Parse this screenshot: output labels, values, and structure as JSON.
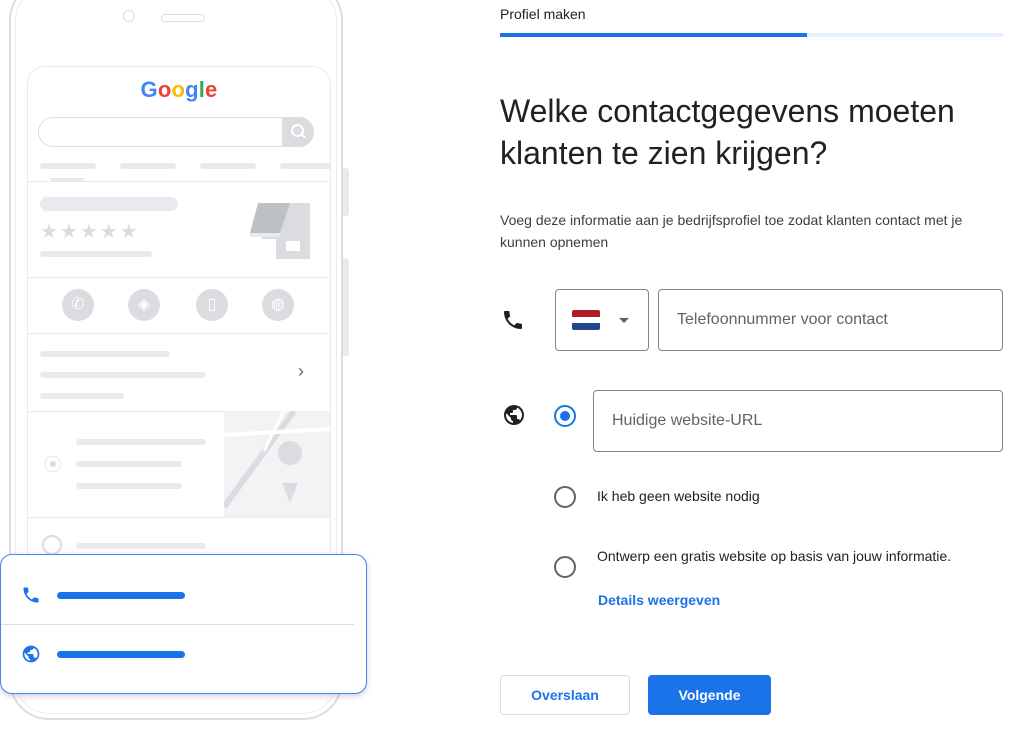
{
  "header": {
    "step_label": "Profiel maken",
    "progress": 0.61
  },
  "main": {
    "heading": "Welke contactgegevens moeten klanten te zien krijgen?",
    "description": "Voeg deze informatie aan je bedrijfsprofiel toe zodat klanten contact met je kunnen opnemen",
    "phone": {
      "country_flag": "NL",
      "placeholder": "Telefoonnummer voor contact",
      "value": ""
    },
    "website": {
      "placeholder": "Huidige website-URL",
      "value": "",
      "options": [
        {
          "label": "Ik heb geen website nodig",
          "selected": false
        },
        {
          "label": "Ontwerp een gratis website op basis van jouw informatie.",
          "selected": false,
          "link": "Details weergeven"
        }
      ],
      "url_option_selected": true
    }
  },
  "footer": {
    "skip_label": "Overslaan",
    "next_label": "Volgende"
  },
  "illustration": {
    "logo_text": "Google"
  },
  "colors": {
    "accent": "#1a73e8",
    "track": "#e8f0fe",
    "border": "#80868b",
    "muted": "#dadce0"
  }
}
